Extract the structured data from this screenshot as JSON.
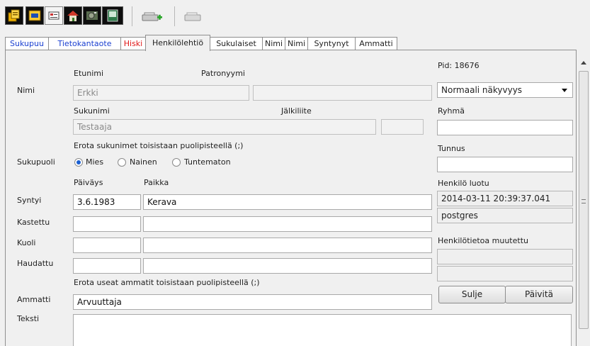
{
  "toolbar": {
    "buttons": [
      {
        "icon": "copy-pages-icon"
      },
      {
        "icon": "db-folder-icon"
      },
      {
        "icon": "card-icon"
      },
      {
        "icon": "home-icon"
      },
      {
        "icon": "photo-icon"
      },
      {
        "icon": "window-icon"
      },
      {
        "icon": "add-record-icon"
      },
      {
        "icon": "remove-record-icon"
      }
    ]
  },
  "tabs": [
    {
      "label": "Sukupuu"
    },
    {
      "label": "Tietokantaote"
    },
    {
      "label": "Hiski"
    },
    {
      "label": "Henkilölehtiö"
    },
    {
      "label": "Sukulaiset"
    },
    {
      "label": "Nimi"
    },
    {
      "label": "Nimi"
    },
    {
      "label": "Syntynyt"
    },
    {
      "label": "Ammatti"
    }
  ],
  "form": {
    "nimi_label": "Nimi",
    "etunimi_label": "Etunimi",
    "patronyymi_label": "Patronyymi",
    "etunimi_value": "Erkki",
    "patronyymi_value": "",
    "sukunimi_label": "Sukunimi",
    "jalkiliite_label": "Jälkiliite",
    "sukunimi_value": "Testaaja",
    "jalkiliite_value": "",
    "surname_hint": "Erota sukunimet toisistaan puolipisteellä (;)",
    "sukupuoli_label": "Sukupuoli",
    "gender_options": [
      "Mies",
      "Nainen",
      "Tuntematon"
    ],
    "gender_selected": "Mies",
    "paivays_label": "Päiväys",
    "paikka_label": "Paikka",
    "events": [
      {
        "label": "Syntyi",
        "date": "3.6.1983",
        "place": "Kerava"
      },
      {
        "label": "Kastettu",
        "date": "",
        "place": ""
      },
      {
        "label": "Kuoli",
        "date": "",
        "place": ""
      },
      {
        "label": "Haudattu",
        "date": "",
        "place": ""
      }
    ],
    "occupation_hint": "Erota useat ammatit toisistaan puolipisteellä (;)",
    "ammatti_label": "Ammatti",
    "ammatti_value": "Arvuuttaja",
    "teksti_label": "Teksti",
    "teksti_value": ""
  },
  "side": {
    "pid": "Pid: 18676",
    "visibility_value": "Normaali näkyvyys",
    "ryhma_label": "Ryhmä",
    "ryhma_value": "",
    "tunnus_label": "Tunnus",
    "tunnus_value": "",
    "created_label": "Henkilö luotu",
    "created_time": "2014-03-11 20:39:37.041",
    "created_by": "postgres",
    "modified_label": "Henkilötietoa muutettu",
    "modified_time": "",
    "modified_by": "",
    "close_button": "Sulje",
    "update_button": "Päivitä"
  },
  "colors": {
    "tab_link": "#1a3fd0",
    "tab_hiski": "#e01818",
    "radio_dot": "#1a5fd1"
  }
}
